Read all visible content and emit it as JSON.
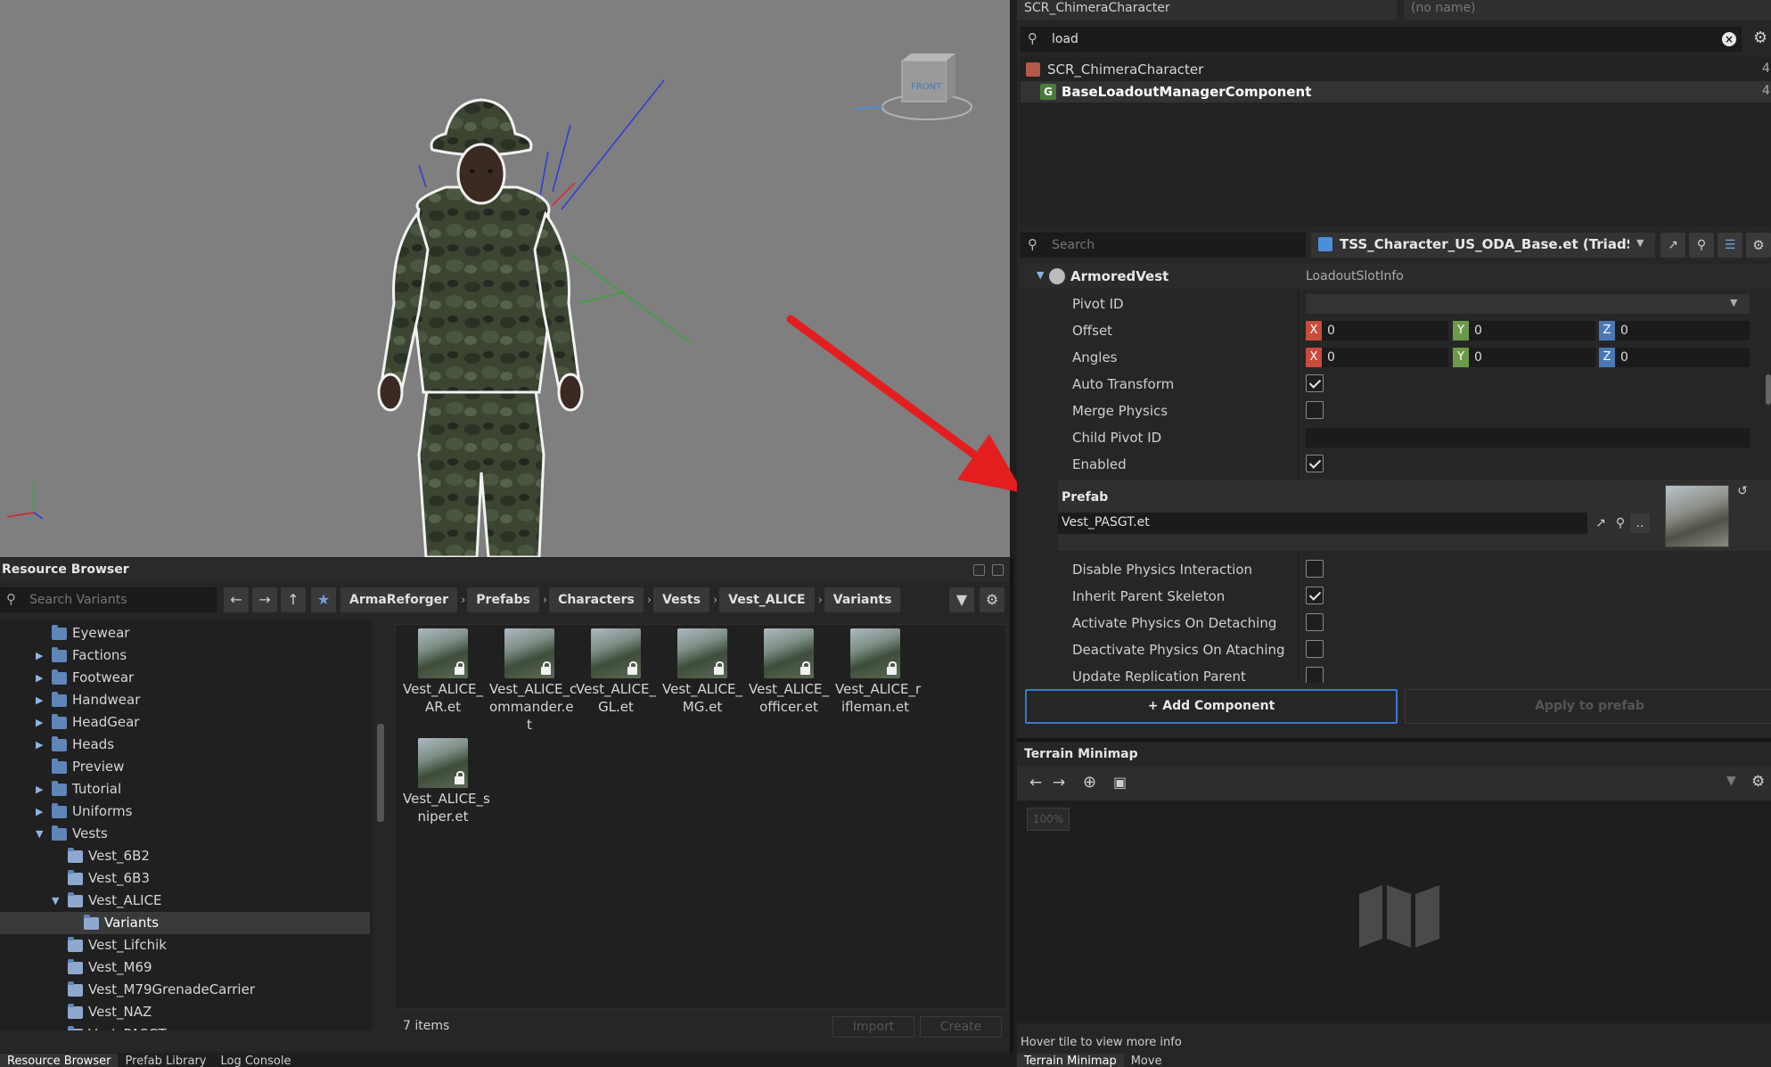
{
  "viewport": {
    "gizmo_label": "FRONT"
  },
  "resource_browser": {
    "title": "Resource Browser",
    "search_placeholder": "Search Variants",
    "breadcrumb": [
      "ArmaReforger",
      "Prefabs",
      "Characters",
      "Vests",
      "Vest_ALICE",
      "Variants"
    ],
    "tree": [
      {
        "label": "Eyewear",
        "level": 1,
        "arrow": ""
      },
      {
        "label": "Factions",
        "level": 1,
        "arrow": "right"
      },
      {
        "label": "Footwear",
        "level": 1,
        "arrow": "right"
      },
      {
        "label": "Handwear",
        "level": 1,
        "arrow": "right"
      },
      {
        "label": "HeadGear",
        "level": 1,
        "arrow": "right"
      },
      {
        "label": "Heads",
        "level": 1,
        "arrow": "right"
      },
      {
        "label": "Preview",
        "level": 1,
        "arrow": ""
      },
      {
        "label": "Tutorial",
        "level": 1,
        "arrow": "right"
      },
      {
        "label": "Uniforms",
        "level": 1,
        "arrow": "right"
      },
      {
        "label": "Vests",
        "level": 1,
        "arrow": "down"
      },
      {
        "label": "Vest_6B2",
        "level": 2,
        "arrow": ""
      },
      {
        "label": "Vest_6B3",
        "level": 2,
        "arrow": ""
      },
      {
        "label": "Vest_ALICE",
        "level": 2,
        "arrow": "down"
      },
      {
        "label": "Variants",
        "level": 3,
        "arrow": "",
        "selected": true
      },
      {
        "label": "Vest_Lifchik",
        "level": 2,
        "arrow": ""
      },
      {
        "label": "Vest_M69",
        "level": 2,
        "arrow": ""
      },
      {
        "label": "Vest_M79GrenadeCarrier",
        "level": 2,
        "arrow": ""
      },
      {
        "label": "Vest_NAZ",
        "level": 2,
        "arrow": ""
      },
      {
        "label": "Vest_PASGT",
        "level": 2,
        "arrow": ""
      }
    ],
    "assets": [
      {
        "line1": "Vest_ALICE_",
        "line2": "AR.et",
        "line3": ""
      },
      {
        "line1": "Vest_ALICE_c",
        "line2": "ommander.e",
        "line3": "t"
      },
      {
        "line1": "Vest_ALICE_",
        "line2": "GL.et",
        "line3": ""
      },
      {
        "line1": "Vest_ALICE_",
        "line2": "MG.et",
        "line3": ""
      },
      {
        "line1": "Vest_ALICE_",
        "line2": "officer.et",
        "line3": ""
      },
      {
        "line1": "Vest_ALICE_r",
        "line2": "ifleman.et",
        "line3": ""
      },
      {
        "line1": "Vest_ALICE_s",
        "line2": "niper.et",
        "line3": ""
      }
    ],
    "items_count": "7 items",
    "import_label": "Import",
    "create_label": "Create",
    "bottom_tabs": [
      "Resource Browser",
      "Prefab Library",
      "Log Console"
    ]
  },
  "hierarchy": {
    "entity_class": "SCR_ChimeraCharacter",
    "entity_name_placeholder": "(no name)",
    "search_value": "load",
    "rows": [
      {
        "label": "SCR_ChimeraCharacter",
        "count": "4",
        "bold": false
      },
      {
        "label": "BaseLoadoutManagerComponent",
        "count": "4",
        "bold": true
      }
    ]
  },
  "properties": {
    "search_placeholder": "Search",
    "prefab_file": "TSS_Character_US_ODA_Base.et (TriadShoo",
    "section_title": "ArmoredVest",
    "section_type": "LoadoutSlotInfo",
    "pivot_id_label": "Pivot ID",
    "offset_label": "Offset",
    "angles_label": "Angles",
    "offset": {
      "x": "0",
      "y": "0",
      "z": "0"
    },
    "angles": {
      "x": "0",
      "y": "0",
      "z": "0"
    },
    "auto_transform_label": "Auto Transform",
    "merge_physics_label": "Merge Physics",
    "child_pivot_label": "Child Pivot ID",
    "enabled_label": "Enabled",
    "prefab_label": "Prefab",
    "prefab_value": "Vest_PASGT.et",
    "disable_physics_label": "Disable Physics Interaction",
    "inherit_skeleton_label": "Inherit Parent Skeleton",
    "activate_physics_label": "Activate Physics On Detaching",
    "deactivate_physics_label": "Deactivate Physics On Ataching",
    "update_replication_label": "Update Replication Parent",
    "add_component_label": "+ Add Component",
    "apply_prefab_label": "Apply to prefab",
    "axis_x": "X",
    "axis_y": "Y",
    "axis_z": "Z",
    "more_label": ".."
  },
  "minimap": {
    "title": "Terrain Minimap",
    "zoom": "100%",
    "hover_info": "Hover tile to view more info",
    "bottom_tabs": [
      "Terrain Minimap",
      "Move"
    ]
  },
  "colors": {
    "accent": "#3a7ad0",
    "arrow": "#e41e1e",
    "axis_x": "#c94b3c",
    "axis_y": "#6c9a48",
    "axis_z": "#4a78b5"
  }
}
